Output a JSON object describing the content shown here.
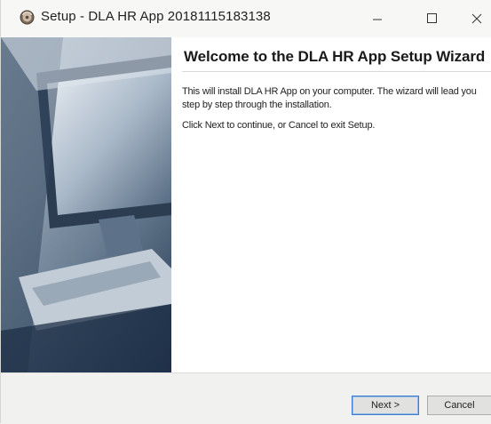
{
  "window": {
    "title": "Setup - DLA HR App 20181115183138",
    "icons": {
      "app": "setup-disc-icon",
      "minimize": "minimize-icon",
      "maximize": "maximize-icon",
      "close": "close-icon"
    }
  },
  "welcome": {
    "heading": "Welcome to the DLA HR App Setup Wizard",
    "paragraph1": "This will install DLA HR App on your computer. The wizard will lead you step by step through the installation.",
    "paragraph2": "Click Next to continue, or Cancel to exit Setup."
  },
  "footer": {
    "next_label": "Next >",
    "cancel_label": "Cancel"
  },
  "colors": {
    "accent_border": "#3c7fd1",
    "content_bg": "#ffffff",
    "chrome_bg": "#f3f3f1"
  }
}
